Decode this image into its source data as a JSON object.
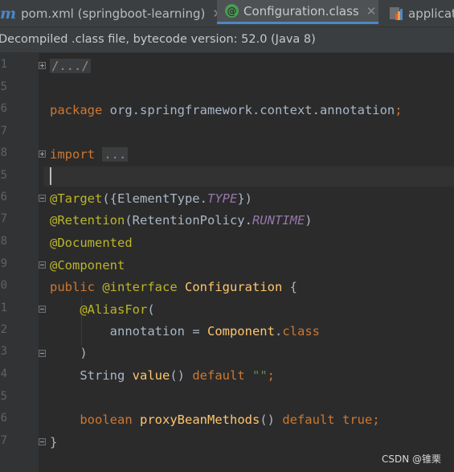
{
  "tabs": [
    {
      "label": "pom.xml (springboot-learning)",
      "icon": "maven-icon"
    },
    {
      "label": "Configuration.class",
      "icon": "annotation-class-icon"
    },
    {
      "label": "applicat",
      "icon": "properties-file-icon"
    }
  ],
  "banner": {
    "text": "Decompiled .class file, bytecode version: 52.0 (Java 8)"
  },
  "line_numbers": [
    "1",
    "5",
    "6",
    "7",
    "8",
    "5",
    "6",
    "7",
    "8",
    "9",
    "0",
    "1",
    "2",
    "3",
    "4",
    "5",
    "6",
    "7"
  ],
  "code": {
    "l1_fold": "/.../",
    "l2_kw": "package",
    "l2_rest": " org.springframework.context.annotation",
    "l2_semi": ";",
    "l3_kw": "import",
    "l3_fold": "...",
    "l4_ann": "@Target",
    "l4_open": "({ElementType.",
    "l4_field": "TYPE",
    "l4_close": "})",
    "l5_ann": "@Retention",
    "l5_open": "(RetentionPolicy.",
    "l5_field": "RUNTIME",
    "l5_close": ")",
    "l6_ann": "@Documented",
    "l7_ann": "@Component",
    "l8_kw": "public",
    "l8_ann": "@interface",
    "l8_name": "Configuration",
    "l8_brace": " {",
    "l9_ann": "@AliasFor",
    "l9_paren": "(",
    "l10_name": "annotation",
    "l10_eq": " = ",
    "l10_type": "Component",
    "l10_dot": ".",
    "l10_kw": "class",
    "l11_paren": ")",
    "l12_type": "String ",
    "l12_fn": "value",
    "l12_parens": "() ",
    "l12_kw": "default",
    "l12_str": "\"\"",
    "l12_semi": ";",
    "l13_kw": "boolean",
    "l13_fn": "proxyBeanMethods",
    "l13_parens": "() ",
    "l13_kw2": "default",
    "l13_kw3": "true",
    "l13_semi": ";",
    "l14_brace": "}"
  },
  "watermark": "CSDN @锥栗",
  "colors": {
    "background": "#2b2b2b",
    "keyword": "#cc7832",
    "annotation": "#bbb529",
    "field": "#9876aa",
    "string": "#6a8759",
    "method": "#ffc66d",
    "text": "#a9b7c6"
  }
}
